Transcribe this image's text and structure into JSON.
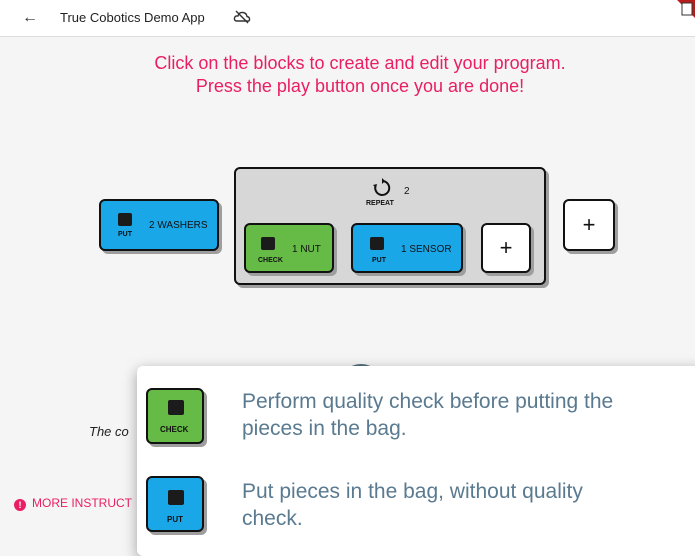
{
  "appbar": {
    "title": "True Cobotics Demo App",
    "back_icon": "arrow-back-icon",
    "status_icon": "cloud-off-icon"
  },
  "instructions": {
    "line1": "Click on the blocks to create and edit your program.",
    "line2": "Press the play button once you are done!"
  },
  "program": {
    "first_block": {
      "qty": "2 WASHERS",
      "type": "PUT"
    },
    "repeat": {
      "label": "REPEAT",
      "count": "2"
    },
    "inner_blocks": [
      {
        "qty": "1 NUT",
        "type": "CHECK"
      },
      {
        "qty": "1 SENSOR",
        "type": "PUT"
      }
    ],
    "add_label": "+"
  },
  "background": {
    "partial_text": "The co",
    "more_instructions": "MORE INSTRUCT"
  },
  "legend": {
    "check": {
      "label": "CHECK",
      "line1": "Perform quality check before putting the",
      "line2": "pieces in the bag."
    },
    "put": {
      "label": "PUT",
      "line1": "Put pieces in the bag, without quality",
      "line2": "check."
    }
  },
  "colors": {
    "accent": "#e91e63",
    "put_block": "#1aa7e8",
    "check_block": "#66bb46",
    "repeat_block": "#d7d7d7",
    "legend_text": "#5a7a90"
  }
}
